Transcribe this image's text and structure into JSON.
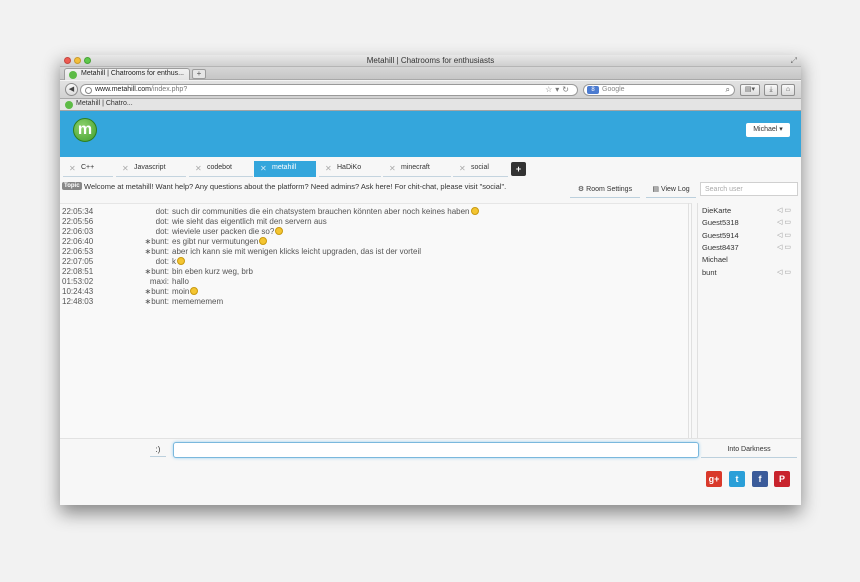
{
  "window": {
    "title": "Metahill | Chatrooms for enthusiasts"
  },
  "browser": {
    "tab_title": "Metahill | Chatrooms for enthus...",
    "new_tab": "+",
    "url_host": "www.metahill.com",
    "url_path": "/index.php?",
    "search_placeholder": "Google",
    "bookmark": "Metahill | Chatro..."
  },
  "header": {
    "logo": "m",
    "user_menu": "Michael ▾"
  },
  "rooms": {
    "tabs": [
      {
        "label": "C++"
      },
      {
        "label": "Javascript"
      },
      {
        "label": "codebot"
      },
      {
        "label": "metahill"
      },
      {
        "label": "HaDiKo"
      },
      {
        "label": "minecraft"
      },
      {
        "label": "social"
      }
    ],
    "active": "metahill",
    "add_label": "+"
  },
  "topic": {
    "badge": "Topic",
    "text": "Welcome at metahill! Want help? Any questions about the platform? Need admins? Ask here! For chit-chat, please visit \"social\"."
  },
  "actions": {
    "room_settings": "Room Settings",
    "view_log": "View Log",
    "search_user_placeholder": "Search user"
  },
  "messages": [
    {
      "time": "22:05:34",
      "nick": "dot:",
      "text": "such dir communities die ein chatsystem brauchen könnten aber noch keines haben",
      "smiley": true
    },
    {
      "time": "22:05:56",
      "nick": "dot:",
      "text": "wie sieht das eigentlich mit den servern aus",
      "smiley": false
    },
    {
      "time": "22:06:03",
      "nick": "dot:",
      "text": "wieviele user packen die so?",
      "smiley": true
    },
    {
      "time": "22:06:40",
      "nick": "∗bunt:",
      "text": "es gibt nur vermutungen",
      "smiley": true
    },
    {
      "time": "22:06:53",
      "nick": "∗bunt:",
      "text": "aber ich kann sie mit wenigen klicks leicht upgraden, das ist der vorteil",
      "smiley": false
    },
    {
      "time": "22:07:05",
      "nick": "dot:",
      "text": "k",
      "smiley": true
    },
    {
      "time": "22:08:51",
      "nick": "∗bunt:",
      "text": "bin eben kurz weg, brb",
      "smiley": false
    },
    {
      "time": "01:53:02",
      "nick": "maxi:",
      "text": "hallo",
      "smiley": false
    },
    {
      "time": "10:24:43",
      "nick": "∗bunt:",
      "text": "moin",
      "smiley": true
    },
    {
      "time": "12:48:03",
      "nick": "∗bunt:",
      "text": "memememem",
      "smiley": false
    }
  ],
  "users": [
    {
      "name": "DieKarte",
      "icons": true
    },
    {
      "name": "Guest5318",
      "icons": true
    },
    {
      "name": "Guest5914",
      "icons": true
    },
    {
      "name": "Guest8437",
      "icons": true
    },
    {
      "name": "Michael",
      "icons": false
    },
    {
      "name": "bunt",
      "icons": true
    }
  ],
  "composer": {
    "smiley_button": ":)",
    "input_value": "",
    "theme_button": "Into Darkness"
  },
  "social": {
    "gplus": "g+",
    "twitter": "t",
    "facebook": "f",
    "pinterest": "P"
  },
  "colors": {
    "brand": "#34a6dc",
    "logo_green": "#5dbb46"
  }
}
